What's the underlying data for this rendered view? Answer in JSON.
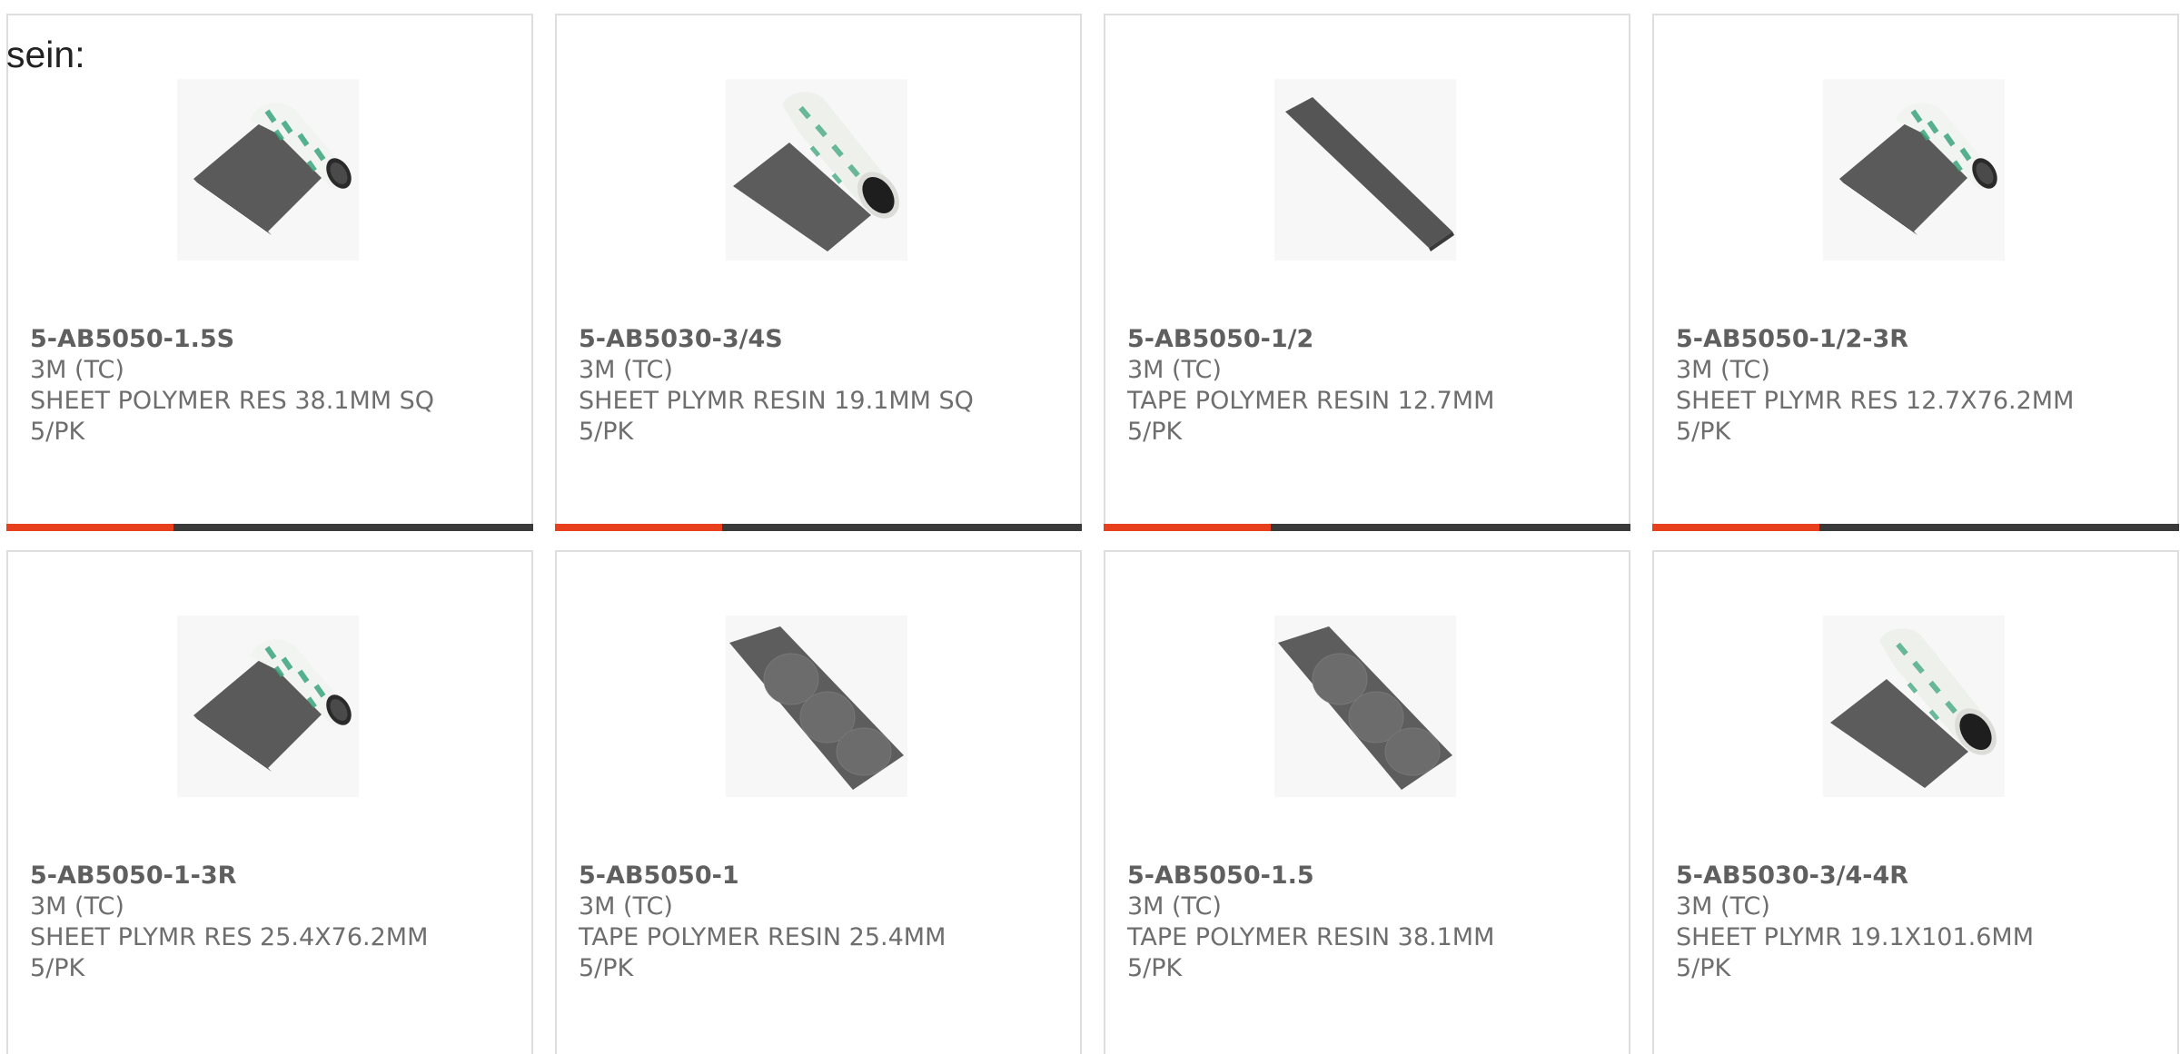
{
  "intro_text": "sein:",
  "colors": {
    "accent": "#e8401c",
    "bar": "#3a3a3a",
    "border": "#dedede",
    "text": "#6e6e6e"
  },
  "products": [
    {
      "part": "5-AB5050-1.5S",
      "brand": "3M (TC)",
      "desc": "SHEET POLYMER RES 38.1MM SQ",
      "pack": "5/PK",
      "image": "roll-sheet"
    },
    {
      "part": "5-AB5030-3/4S",
      "brand": "3M (TC)",
      "desc": "SHEET PLYMR RESIN 19.1MM SQ",
      "pack": "5/PK",
      "image": "roll-tube"
    },
    {
      "part": "5-AB5050-1/2",
      "brand": "3M (TC)",
      "desc": "TAPE POLYMER RESIN 12.7MM",
      "pack": "5/PK",
      "image": "tape-strip"
    },
    {
      "part": "5-AB5050-1/2-3R",
      "brand": "3M (TC)",
      "desc": "SHEET PLYMR RES 12.7X76.2MM",
      "pack": "5/PK",
      "image": "roll-sheet"
    },
    {
      "part": "5-AB5050-1-3R",
      "brand": "3M (TC)",
      "desc": "SHEET PLYMR RES 25.4X76.2MM",
      "pack": "5/PK",
      "image": "roll-sheet"
    },
    {
      "part": "5-AB5050-1",
      "brand": "3M (TC)",
      "desc": "TAPE POLYMER RESIN 25.4MM",
      "pack": "5/PK",
      "image": "tape-dots"
    },
    {
      "part": "5-AB5050-1.5",
      "brand": "3M (TC)",
      "desc": "TAPE POLYMER RESIN 38.1MM",
      "pack": "5/PK",
      "image": "tape-dots"
    },
    {
      "part": "5-AB5030-3/4-4R",
      "brand": "3M (TC)",
      "desc": "SHEET PLYMR 19.1X101.6MM",
      "pack": "5/PK",
      "image": "roll-tube"
    }
  ]
}
